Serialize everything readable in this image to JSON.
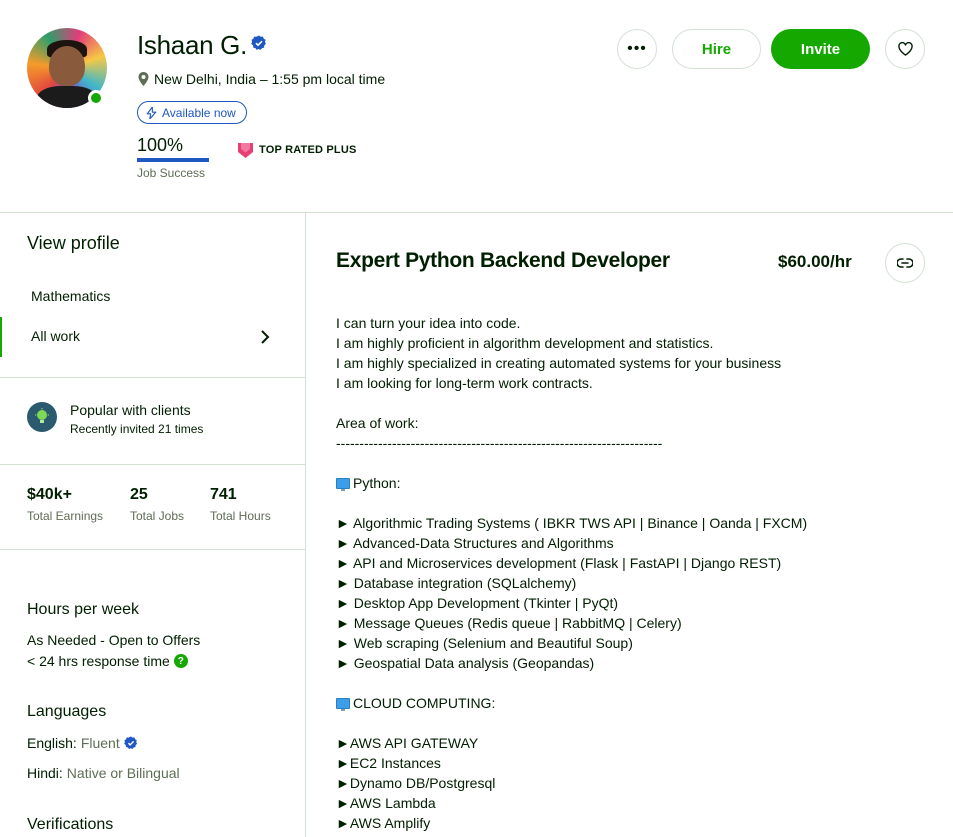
{
  "profile": {
    "name": "Ishaan G.",
    "location": "New Delhi, India – 1:55 pm local time",
    "availability": "Available now",
    "job_success_value": "100%",
    "job_success_label": "Job Success",
    "job_success_fraction": 1.0,
    "badge": "TOP RATED PLUS"
  },
  "actions": {
    "more": "•••",
    "hire": "Hire",
    "invite": "Invite"
  },
  "sidebar": {
    "view_profile": "View profile",
    "items": [
      {
        "label": "Mathematics"
      },
      {
        "label": "All work"
      }
    ],
    "popular": {
      "title": "Popular with clients",
      "subtitle": "Recently invited 21 times"
    },
    "stats": [
      {
        "value": "$40k+",
        "label": "Total Earnings"
      },
      {
        "value": "25",
        "label": "Total Jobs"
      },
      {
        "value": "741",
        "label": "Total Hours"
      }
    ],
    "hours_per_week": {
      "title": "Hours per week",
      "line1": "As Needed - Open to Offers",
      "line2": "< 24 hrs response time"
    },
    "languages": {
      "title": "Languages",
      "items": [
        {
          "name": "English:",
          "level": "Fluent"
        },
        {
          "name": "Hindi:",
          "level": "Native or Bilingual"
        }
      ]
    },
    "verifications_title": "Verifications"
  },
  "main": {
    "title": "Expert Python Backend Developer",
    "rate": "$60.00/hr",
    "description": [
      "I can turn your idea into code.",
      "I am highly proficient in algorithm development and statistics.",
      "I am highly specialized in creating automated systems for your business",
      "I am looking for long-term work contracts.",
      "",
      "Area of work:",
      "----------------------------------------------------------------------",
      "",
      "Python:",
      "",
      "► Algorithmic Trading Systems ( IBKR TWS API | Binance | Oanda | FXCM)",
      "► Advanced-Data Structures and Algorithms",
      "► API and Microservices development (Flask | FastAPI | Django REST)",
      "► Database integration (SQLalchemy)",
      "► Desktop App Development (Tkinter | PyQt)",
      "► Message Queues (Redis queue | RabbitMQ | Celery)",
      "► Web scraping (Selenium and Beautiful Soup)",
      "► Geospatial Data analysis (Geopandas)",
      "",
      "CLOUD COMPUTING:",
      "",
      "►AWS API GATEWAY",
      "►EC2 Instances",
      "►Dynamo DB/Postgresql",
      "►AWS Lambda",
      "►AWS Amplify"
    ],
    "monitor_lines": [
      8,
      19
    ]
  },
  "colors": {
    "brand_green": "#14a800",
    "accent_blue": "#1f57c3",
    "text": "#001e00",
    "muted": "#5e6d55",
    "border": "#d5e0d5"
  }
}
